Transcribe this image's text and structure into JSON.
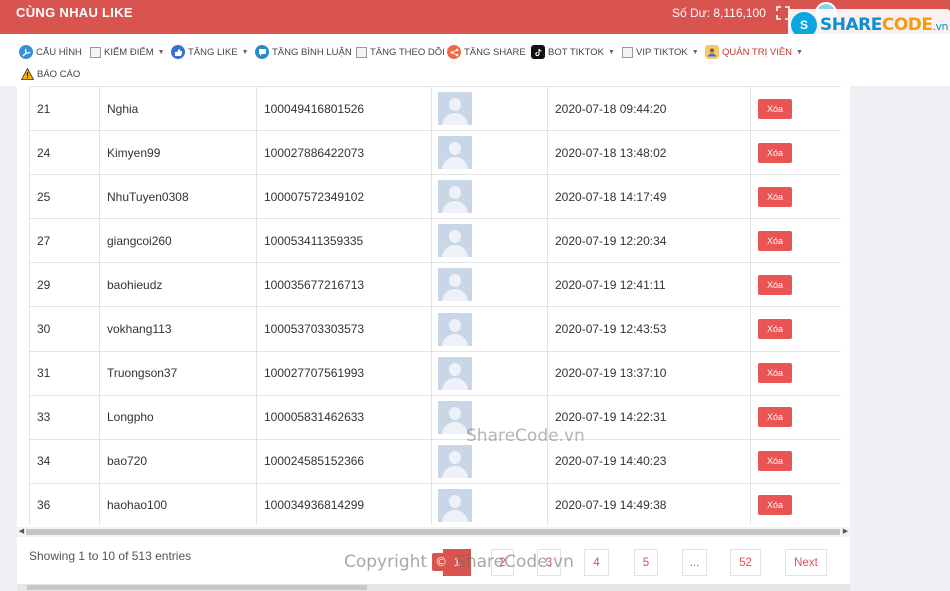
{
  "topbar": {
    "brand": "CÙNG NHAU LIKE",
    "balance": "Số Dư: 8,116,100",
    "color": "#d9534f"
  },
  "watermark_logo": {
    "badge": "S",
    "text_main": "SHARE",
    "text_accent": "CODE",
    "text_suffix": ".vn"
  },
  "nav": {
    "items": [
      {
        "label": "CẤU HÌNH",
        "icon": "wrench-icon"
      },
      {
        "label": "KIẾM ĐIỂM",
        "icon": "image-icon",
        "chevron": true
      },
      {
        "label": "TĂNG LIKE",
        "icon": "thumbs-up-icon",
        "chevron": true
      },
      {
        "label": "TĂNG BÌNH LUẬN",
        "icon": "comment-icon"
      },
      {
        "label": "TĂNG THEO DÕI",
        "icon": "image-icon"
      },
      {
        "label": "TĂNG SHARE",
        "icon": "share-icon"
      },
      {
        "label": "BOT TIKTOK",
        "icon": "tiktok-icon",
        "chevron": true
      },
      {
        "label": "VIP TIKTOK",
        "icon": "image-icon",
        "chevron": true
      },
      {
        "label": "QUẢN TRỊ VIÊN",
        "icon": "admin-icon",
        "chevron": true
      },
      {
        "label": "BÁO CÁO",
        "icon": "warning-icon"
      }
    ]
  },
  "table": {
    "rows": [
      {
        "id": "21",
        "name": "Nghia",
        "uid": "100049416801526",
        "time": "2020-07-18 09:44:20",
        "action": "Xóa"
      },
      {
        "id": "24",
        "name": "Kimyen99",
        "uid": "100027886422073",
        "time": "2020-07-18 13:48:02",
        "action": "Xóa"
      },
      {
        "id": "25",
        "name": "NhuTuyen0308",
        "uid": "100007572349102",
        "time": "2020-07-18 14:17:49",
        "action": "Xóa"
      },
      {
        "id": "27",
        "name": "giangcoi260",
        "uid": "100053411359335",
        "time": "2020-07-19 12:20:34",
        "action": "Xóa"
      },
      {
        "id": "29",
        "name": "baohieudz",
        "uid": "100035677216713",
        "time": "2020-07-19 12:41:11",
        "action": "Xóa"
      },
      {
        "id": "30",
        "name": "vokhang113",
        "uid": "100053703303573",
        "time": "2020-07-19 12:43:53",
        "action": "Xóa"
      },
      {
        "id": "31",
        "name": "Truongson37",
        "uid": "100027707561993",
        "time": "2020-07-19 13:37:10",
        "action": "Xóa"
      },
      {
        "id": "33",
        "name": "Longpho",
        "uid": "100005831462633",
        "time": "2020-07-19 14:22:31",
        "action": "Xóa"
      },
      {
        "id": "34",
        "name": "bao720",
        "uid": "100024585152366",
        "time": "2020-07-19 14:40:23",
        "action": "Xóa"
      },
      {
        "id": "36",
        "name": "haohao100",
        "uid": "100034936814299",
        "time": "2020-07-19 14:49:38",
        "action": "Xóa"
      }
    ]
  },
  "footer": {
    "info": "Showing 1 to 10 of 513 entries",
    "pages": [
      {
        "label": "1",
        "active": true
      },
      {
        "label": "2"
      },
      {
        "label": "3"
      },
      {
        "label": "4"
      },
      {
        "label": "5"
      },
      {
        "label": "..."
      },
      {
        "label": "52"
      },
      {
        "label": "Next"
      }
    ]
  },
  "watermarks": {
    "center": "ShareCode.vn",
    "bottom_pre": "Copyright",
    "bottom_symbol": "©",
    "bottom_post": "ShareCode.vn"
  }
}
